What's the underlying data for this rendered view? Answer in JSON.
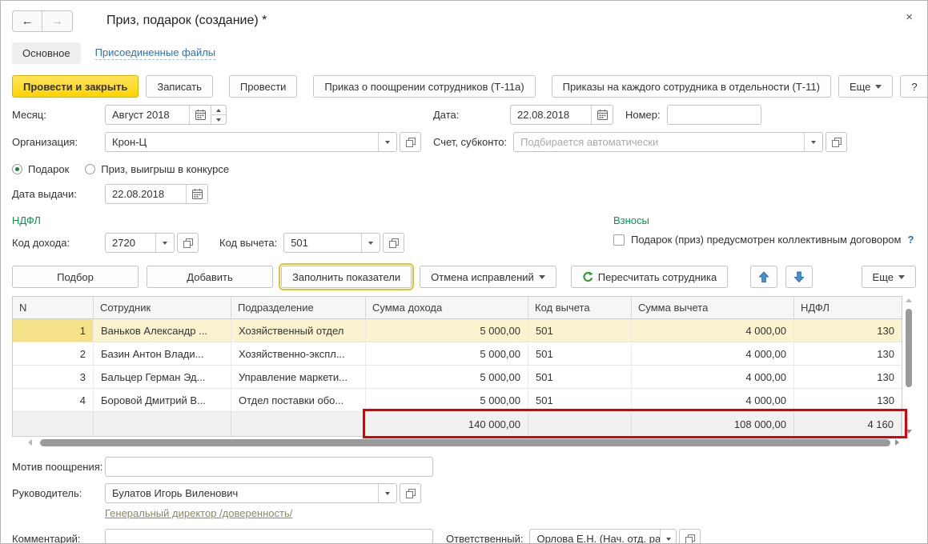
{
  "accent": {
    "green": "#009a44",
    "link_blue": "#2d71b8",
    "highlight_red": "#e00000",
    "primary_yellow": "#ffd400"
  },
  "window": {
    "title": "Приз, подарок (создание) *",
    "close": "×",
    "back": "←",
    "forward": "→"
  },
  "tabs": {
    "main": "Основное",
    "attached": "Присоединенные файлы"
  },
  "toolbar": {
    "post_close": "Провести и закрыть",
    "write": "Записать",
    "post": "Провести",
    "order_t11a": "Приказ о поощрении сотрудников (Т-11а)",
    "order_t11": "Приказы на каждого сотрудника в отдельности (Т-11)",
    "more": "Еще",
    "help": "?"
  },
  "fields": {
    "month": {
      "label": "Месяц:",
      "value": "Август 2018"
    },
    "date": {
      "label": "Дата:",
      "value": "22.08.2018"
    },
    "number": {
      "label": "Номер:",
      "value": ""
    },
    "organization": {
      "label": "Организация:",
      "value": "Крон-Ц"
    },
    "account": {
      "label": "Счет, субконто:",
      "placeholder": "Подбирается автоматически"
    },
    "radio_gift": "Подарок",
    "radio_prize": "Приз, выигрыш в конкурсе",
    "issue_date": {
      "label": "Дата выдачи:",
      "value": "22.08.2018"
    },
    "ndfl_section": "НДФЛ",
    "income_code": {
      "label": "Код дохода:",
      "value": "2720"
    },
    "deduction_code": {
      "label": "Код вычета:",
      "value": "501"
    },
    "contributions_section": "Взносы",
    "collective_checkbox": "Подарок (приз) предусмотрен коллективным договором",
    "collective_help": "?"
  },
  "table_toolbar": {
    "pick": "Подбор",
    "add": "Добавить",
    "fill": "Заполнить показатели",
    "undo": "Отмена исправлений",
    "recalc": "Пересчитать сотрудника",
    "more": "Еще"
  },
  "table": {
    "columns": [
      "N",
      "Сотрудник",
      "Подразделение",
      "Сумма дохода",
      "Код вычета",
      "Сумма вычета",
      "НДФЛ"
    ],
    "rows": [
      {
        "n": "1",
        "employee": "Ваньков Александр ...",
        "department": "Хозяйственный отдел",
        "income": "5 000,00",
        "deduction_code": "501",
        "deduction": "4 000,00",
        "ndfl": "130"
      },
      {
        "n": "2",
        "employee": "Базин Антон Влади...",
        "department": "Хозяйственно-экспл...",
        "income": "5 000,00",
        "deduction_code": "501",
        "deduction": "4 000,00",
        "ndfl": "130"
      },
      {
        "n": "3",
        "employee": "Бальцер Герман Эд...",
        "department": "Управление маркети...",
        "income": "5 000,00",
        "deduction_code": "501",
        "deduction": "4 000,00",
        "ndfl": "130"
      },
      {
        "n": "4",
        "employee": "Боровой Дмитрий В...",
        "department": "Отдел поставки обо...",
        "income": "5 000,00",
        "deduction_code": "501",
        "deduction": "4 000,00",
        "ndfl": "130"
      }
    ],
    "totals": {
      "income": "140 000,00",
      "deduction": "108 000,00",
      "ndfl": "4 160"
    }
  },
  "footer": {
    "motive": {
      "label": "Мотив поощрения:",
      "value": ""
    },
    "manager": {
      "label": "Руководитель:",
      "value": "Булатов Игорь Виленович"
    },
    "manager_link": "Генеральный директор  /доверенность/",
    "comment": {
      "label": "Комментарий:",
      "value": ""
    },
    "responsible": {
      "label": "Ответственный:",
      "value": "Орлова Е.Н. (Нач. отд. ра"
    }
  }
}
